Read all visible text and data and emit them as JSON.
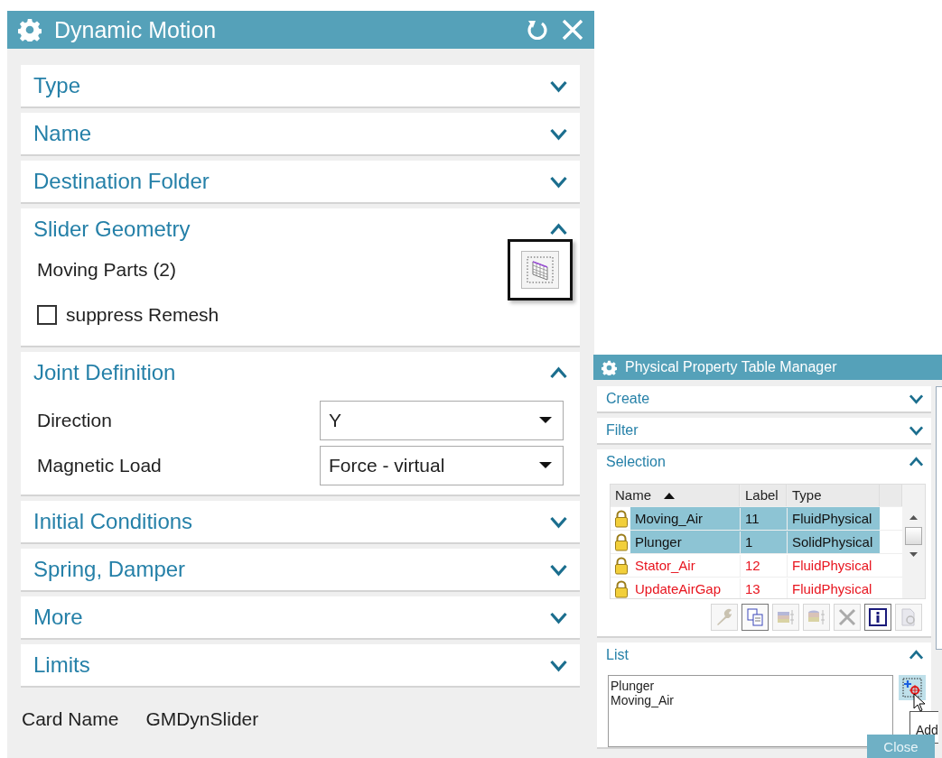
{
  "dynamic_motion": {
    "title": "Dynamic Motion",
    "sections": [
      {
        "kind": "header",
        "title": "Type",
        "expanded": false
      },
      {
        "kind": "header",
        "title": "Name",
        "expanded": false
      },
      {
        "kind": "header",
        "title": "Destination Folder",
        "expanded": false
      },
      {
        "kind": "slider",
        "title": "Slider Geometry",
        "expanded": true,
        "selector_label": "Moving Parts (2)",
        "suppress_remesh": {
          "label": "suppress Remesh",
          "checked": false
        }
      },
      {
        "kind": "joint",
        "title": "Joint Definition",
        "expanded": true,
        "fields": [
          {
            "label": "Direction",
            "value": "Y"
          },
          {
            "label": "Magnetic Load",
            "value": "Force - virtual"
          }
        ]
      },
      {
        "kind": "header",
        "title": "Initial Conditions",
        "expanded": false
      },
      {
        "kind": "header",
        "title": "Spring, Damper",
        "expanded": false
      },
      {
        "kind": "header",
        "title": "More",
        "expanded": false
      },
      {
        "kind": "header",
        "title": "Limits",
        "expanded": false
      }
    ],
    "card_name": {
      "label": "Card Name",
      "value": "GMDynSlider"
    }
  },
  "property_manager": {
    "title": "Physical Property Table Manager",
    "sections": [
      {
        "kind": "header",
        "title": "Create",
        "expanded": false
      },
      {
        "kind": "header",
        "title": "Filter",
        "expanded": false
      },
      {
        "kind": "selection",
        "title": "Selection",
        "expanded": true,
        "table": {
          "columns": [
            "Name",
            "Label",
            "Type"
          ],
          "rows": [
            {
              "cells": [
                "Moving_Air",
                "11",
                "FluidPhysical"
              ],
              "selected": true
            },
            {
              "cells": [
                "Plunger",
                "1",
                "SolidPhysical"
              ],
              "selected": true
            },
            {
              "cells": [
                "Stator_Air",
                "12",
                "FluidPhysical"
              ],
              "selected": false,
              "color": "#e8141e"
            },
            {
              "cells": [
                "UpdateAirGap",
                "13",
                "FluidPhysical"
              ],
              "selected": false,
              "color": "#e8141e"
            }
          ]
        },
        "tools": [
          {
            "kind": "wrench",
            "disabled": true
          },
          {
            "kind": "copy",
            "disabled": false
          },
          {
            "kind": "table",
            "disabled": true
          },
          {
            "kind": "stack",
            "disabled": true
          },
          {
            "kind": "delete",
            "disabled": true
          },
          {
            "kind": "info",
            "disabled": false
          },
          {
            "kind": "preview",
            "disabled": true
          }
        ]
      },
      {
        "kind": "list",
        "title": "List",
        "expanded": true,
        "items": [
          "Plunger",
          "Moving_Air"
        ],
        "add_tooltip": "Add"
      }
    ],
    "close_button": "Close"
  }
}
